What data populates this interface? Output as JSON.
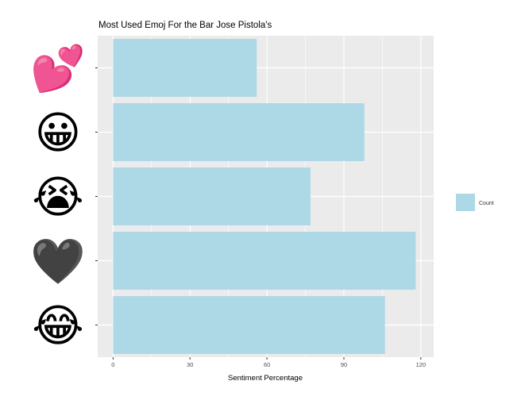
{
  "chart_data": {
    "type": "bar",
    "orientation": "horizontal",
    "title": "Most Used Emoj For the Bar Jose Pistola's",
    "xlabel": "Sentiment Percentage",
    "ylabel": "",
    "categories": [
      "two-hearts",
      "grinning-face",
      "loudly-crying-face",
      "black-heart",
      "face-with-tears-of-joy"
    ],
    "category_icons": [
      "💕",
      "😀",
      "😭",
      "🖤",
      "😂"
    ],
    "values": [
      56,
      98,
      77,
      118,
      106
    ],
    "xlim": [
      -6,
      125
    ],
    "xticks": [
      0,
      30,
      60,
      90,
      120
    ],
    "grid": true,
    "legend": {
      "position": "right",
      "label": "Count",
      "color": "#add8e6"
    },
    "colors": {
      "bar": "#add8e6",
      "panel": "#ebebeb",
      "grid": "#ffffff"
    }
  }
}
